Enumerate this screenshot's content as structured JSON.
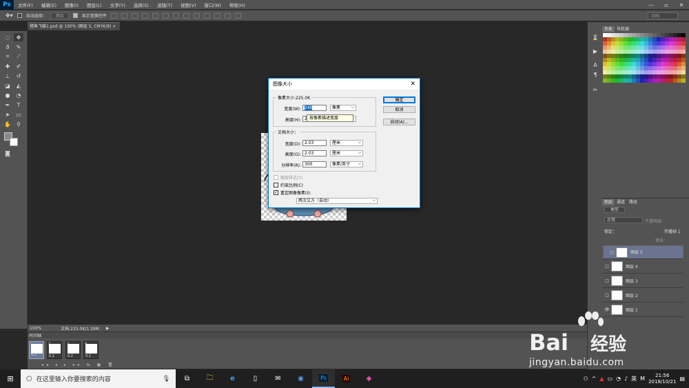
{
  "menubar": {
    "logo": "Ps",
    "items": [
      "文件(F)",
      "编辑(E)",
      "图像(I)",
      "图层(L)",
      "文字(Y)",
      "选择(S)",
      "滤镜(T)",
      "视图(V)",
      "窗口(W)",
      "帮助(H)"
    ]
  },
  "options": {
    "auto_select": "自动选择：",
    "auto_select_value": "图层",
    "show_transform": "显示变换控件",
    "workspace": "动画"
  },
  "document": {
    "tab_title": "猪鱼飞碟1.psd @ 100% (图层 5, CMYK/8)",
    "zoom": "100%",
    "doc_info": "文档:225.0K/1.39M"
  },
  "timeline": {
    "title": "时间轴",
    "frames": [
      {
        "num": "1",
        "delay": "0.2"
      },
      {
        "num": "2",
        "delay": "0.2"
      },
      {
        "num": "3",
        "delay": "0.2"
      },
      {
        "num": "4",
        "delay": "0.2"
      }
    ]
  },
  "panels": {
    "swatch_tab": "色板",
    "swatch_tab2": "导航器",
    "layers_tab": "图层",
    "channels_tab": "通道",
    "paths_tab": "路径",
    "kind": "类型",
    "blend": "正常",
    "opacity_label": "不透明度：",
    "lock_label": "锁定：",
    "fill_label": "填充：",
    "propagate": "传播帧 1",
    "layers": [
      {
        "name": "图层 5",
        "selected": true,
        "visible": false
      },
      {
        "name": "图层 4",
        "selected": false,
        "visible": false
      },
      {
        "name": "图层 3",
        "selected": false,
        "visible": false
      },
      {
        "name": "图层 2",
        "selected": false,
        "visible": false
      },
      {
        "name": "图层 1",
        "selected": false,
        "visible": true
      }
    ]
  },
  "dialog": {
    "title": "图像大小",
    "pixel_group": "像素大小:225.0K",
    "width_label": "宽度(W):",
    "width_value": "240",
    "height_label": "高度(H):",
    "height_value": "24",
    "pixel_unit": "像素",
    "doc_group": "文档大小：",
    "doc_width_label": "宽度(D):",
    "doc_width_value": "2.03",
    "doc_height_label": "高度(G):",
    "doc_height_value": "2.03",
    "cm_unit": "厘米",
    "res_label": "分辨率(R):",
    "res_value": "300",
    "res_unit": "像素/英寸",
    "scale_styles": "缩放样式(Y)",
    "constrain": "约束比例(C)",
    "resample": "重定图像像素(I):",
    "resample_method": "两次立方（自动）",
    "ok": "确定",
    "cancel": "取消",
    "auto": "自动(A)...",
    "tooltip": "按像素描述宽度"
  },
  "taskbar": {
    "search_placeholder": "在这里输入你要搜索的内容",
    "ime": "英",
    "time": "21:56",
    "date": "2018/10/21"
  },
  "watermark": {
    "brand": "Bai",
    "brand2": "经验",
    "site": "jingyan.baidu.com"
  },
  "colors": {
    "ps_panel": "#535353",
    "canvas": "#282828",
    "dialog_border": "#0078d7",
    "taskbar": "#1f1f1f"
  }
}
